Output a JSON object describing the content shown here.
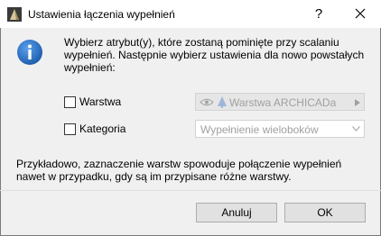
{
  "window": {
    "title": "Ustawienia łączenia wypełnień",
    "help_label": "?"
  },
  "intro_text": "Wybierz atrybut(y), które zostaną pominięte przy scalaniu wypełnień. Następnie wybierz ustawienia dla nowo powstałych wypełnień:",
  "rows": [
    {
      "label": "Warstwa",
      "checked": false,
      "dropdown_value": "Warstwa ARCHICADa"
    },
    {
      "label": "Kategoria",
      "checked": false,
      "dropdown_value": "Wypełnienie wieloboków"
    }
  ],
  "example_text": "Przykładowo, zaznaczenie warstw spowoduje połączenie wypełnień nawet w przypadku, gdy są im przypisane różne warstwy.",
  "buttons": {
    "cancel": "Anuluj",
    "ok": "OK"
  },
  "colors": {
    "info_icon": "#2b6cc4",
    "background": "#f0f0f0"
  }
}
